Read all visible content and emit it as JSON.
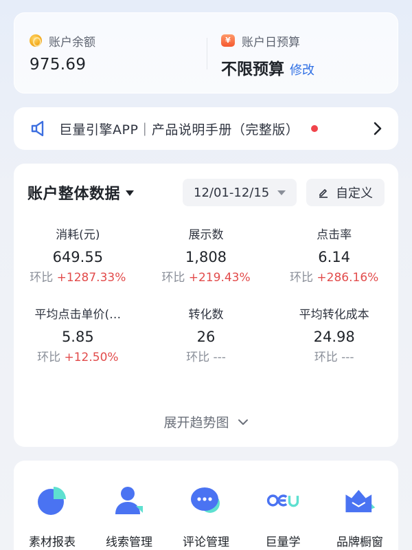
{
  "balance": {
    "label": "账户余额",
    "value": "975.69"
  },
  "daily_budget": {
    "label": "账户日预算",
    "value": "不限预算",
    "modify_label": "修改",
    "icon_glyph": "¥"
  },
  "notice": {
    "text": "巨量引擎APP｜产品说明手册（完整版）"
  },
  "data_section": {
    "title": "账户整体数据",
    "date_range": "12/01-12/15",
    "custom_label": "自定义",
    "compare_prefix": "环比",
    "metrics": [
      {
        "label": "消耗(元)",
        "value": "649.55",
        "delta": "+1287.33%"
      },
      {
        "label": "展示数",
        "value": "1,808",
        "delta": "+219.43%"
      },
      {
        "label": "点击率",
        "value": "6.14",
        "delta": "+286.16%"
      },
      {
        "label": "平均点击单价(…",
        "value": "5.85",
        "delta": "+12.50%"
      },
      {
        "label": "转化数",
        "value": "26",
        "delta": "---"
      },
      {
        "label": "平均转化成本",
        "value": "24.98",
        "delta": "---"
      }
    ],
    "expand_label": "展开趋势图"
  },
  "tools": [
    {
      "label": "素材报表",
      "icon": "pie-chart-icon"
    },
    {
      "label": "线索管理",
      "icon": "user-icon"
    },
    {
      "label": "评论管理",
      "icon": "chat-bubble-icon"
    },
    {
      "label": "巨量学",
      "icon": "oceanengine-logo-icon"
    },
    {
      "label": "品牌橱窗",
      "icon": "crown-mail-icon"
    }
  ],
  "colors": {
    "accent_blue": "#2f6fe4",
    "delta_red": "#e24b4b",
    "notice_dot": "#f0444b",
    "icon_blue": "#4a73f2",
    "icon_teal": "#5ee0d0"
  }
}
